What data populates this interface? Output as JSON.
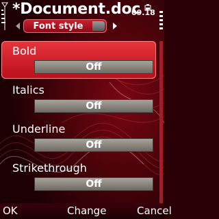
{
  "header": {
    "title": "*Document.doc",
    "time": "09.18"
  },
  "tab": {
    "label": "Font style"
  },
  "items": [
    {
      "label": "Bold",
      "value": "Off"
    },
    {
      "label": "Italics",
      "value": "Off"
    },
    {
      "label": "Underline",
      "value": "Off"
    },
    {
      "label": "Strikethrough",
      "value": "Off"
    }
  ],
  "softkeys": {
    "left": "OK",
    "middle": "Change",
    "right": "Cancel"
  },
  "colors": {
    "accent": "#d6222e",
    "background": "#2a0006",
    "value_field": "#8a867e"
  },
  "icons": [
    "signal-icon",
    "battery-icon",
    "battery-level-icon",
    "arrow-left-icon",
    "arrow-right-icon"
  ]
}
